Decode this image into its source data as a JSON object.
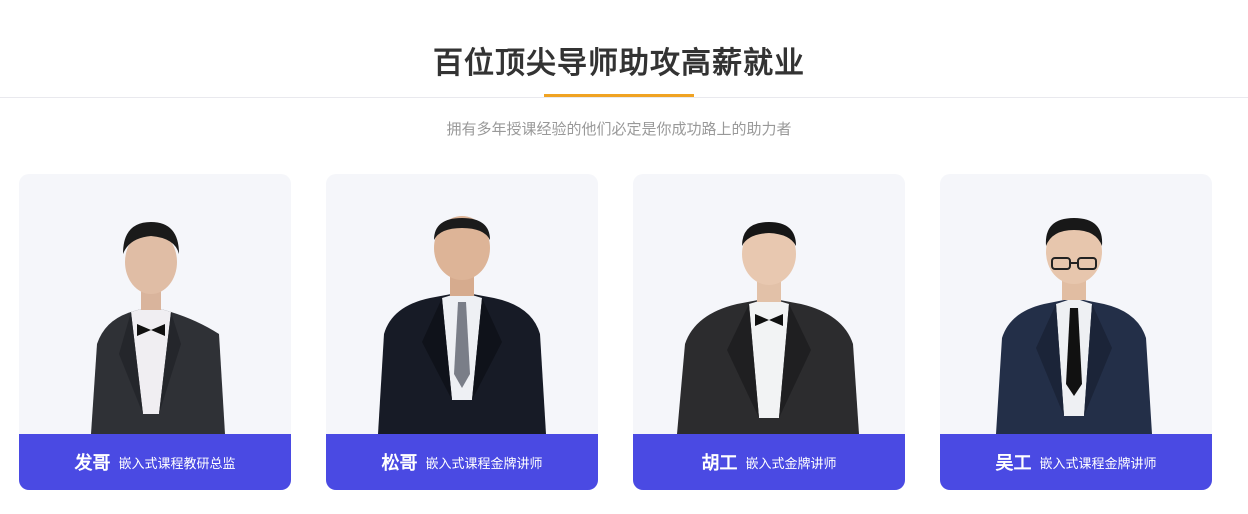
{
  "header": {
    "title": "百位顶尖导师助攻高薪就业",
    "subtitle": "拥有多年授课经验的他们必定是你成功路上的助力者",
    "accent_color": "#f0a323"
  },
  "teachers": [
    {
      "name": "发哥",
      "role": "嵌入式课程教研总监"
    },
    {
      "name": "松哥",
      "role": "嵌入式课程金牌讲师"
    },
    {
      "name": "胡工",
      "role": "嵌入式金牌讲师"
    },
    {
      "name": "吴工",
      "role": "嵌入式课程金牌讲师"
    }
  ],
  "colors": {
    "nameplate_bg": "#4a4ae3",
    "card_bg": "#f5f6fa"
  }
}
